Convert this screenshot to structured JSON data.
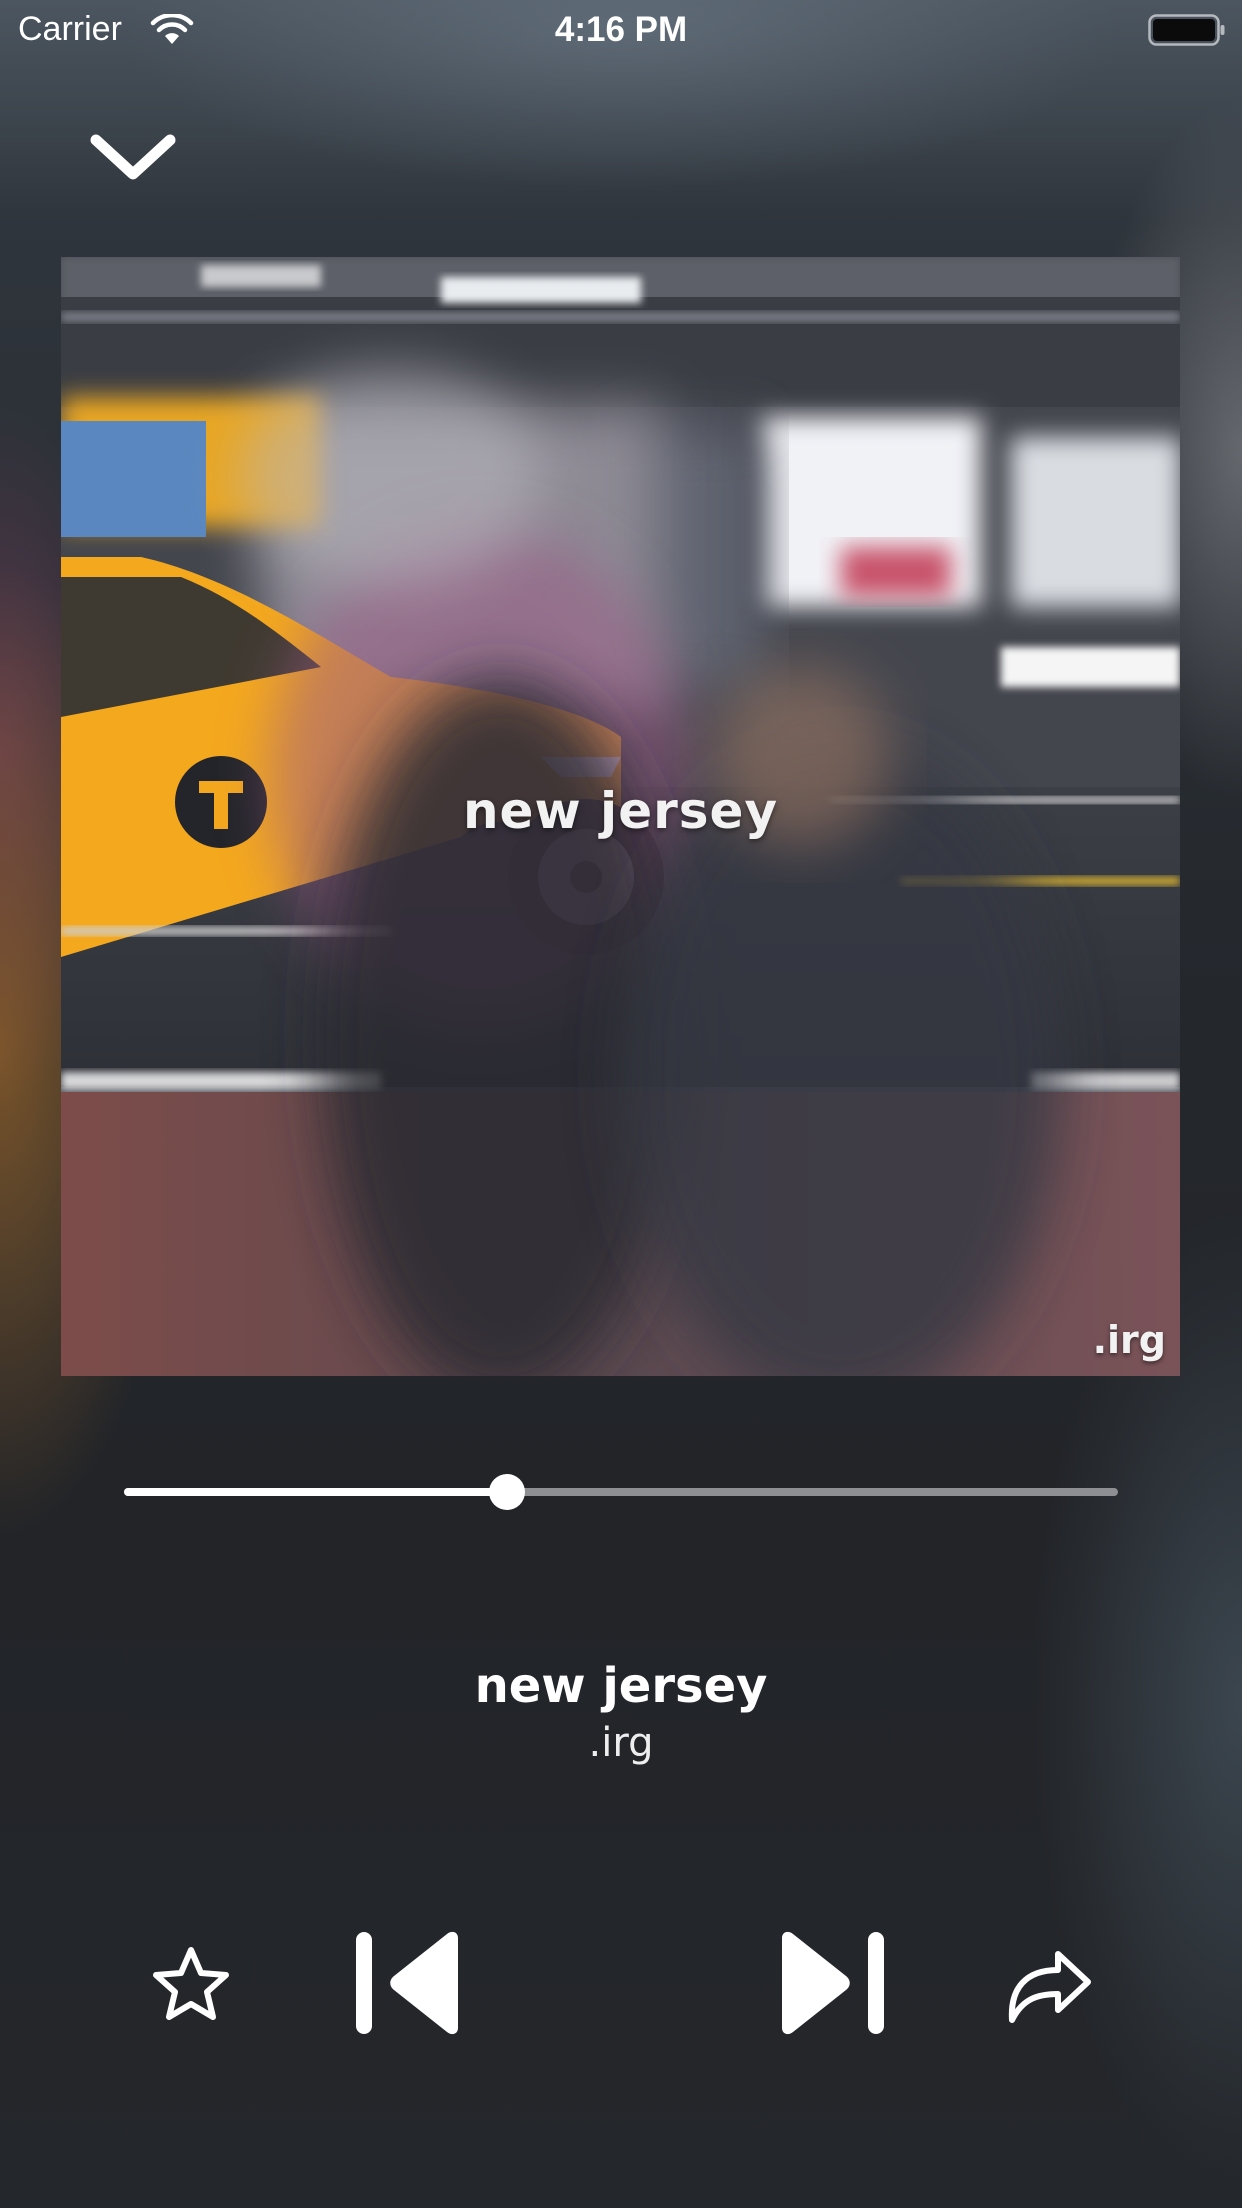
{
  "status_bar": {
    "carrier": "Carrier",
    "time": "4:16 PM",
    "icons": [
      "wifi-icon",
      "battery-icon"
    ]
  },
  "header": {
    "collapse_icon": "chevron-down-icon"
  },
  "artwork": {
    "title_text": "new jersey",
    "artist_text": ".irg",
    "taxi_logo_letter": "T"
  },
  "player": {
    "progress": 0.385
  },
  "track": {
    "title": "new jersey",
    "artist": ".irg"
  },
  "controls": {
    "favorite_icon": "star-outline-icon",
    "previous_icon": "skip-previous-icon",
    "next_icon": "skip-next-icon",
    "share_icon": "share-arrow-icon"
  },
  "colors": {
    "background": "#23262b",
    "foreground": "#ffffff",
    "track_inactive": "#8e8f92",
    "taxi_yellow": "#f4a81e"
  }
}
